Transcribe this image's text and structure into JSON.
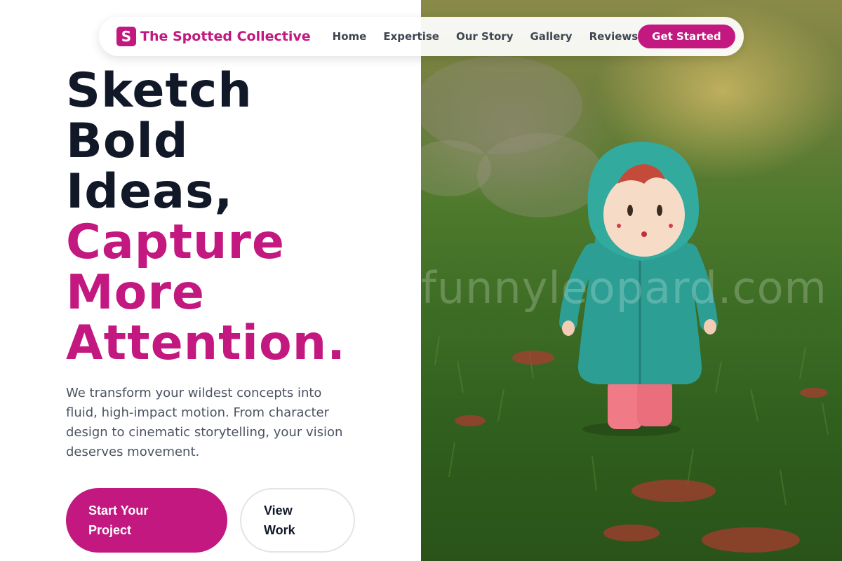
{
  "nav": {
    "brand_mark": "S",
    "brand_name": "The Spotted Collective",
    "links": [
      {
        "label": "Home"
      },
      {
        "label": "Expertise"
      },
      {
        "label": "Our Story"
      },
      {
        "label": "Gallery"
      },
      {
        "label": "Reviews"
      }
    ],
    "cta_label": "Get Started"
  },
  "hero": {
    "headline_dark": [
      "Sketch",
      "Bold",
      "Ideas,"
    ],
    "headline_accent": [
      "Capture",
      "More",
      "Attention."
    ],
    "subtext": "We transform your wildest concepts into fluid, high-impact motion. From character design to cinematic storytelling, your vision deserves movement.",
    "primary_button_label": "Start Your Project",
    "secondary_button_label": "View Work"
  },
  "photo": {
    "subject": "toy figurine in teal hooded raincoat standing on grass",
    "watermark": "funnyleopard.com"
  },
  "colors": {
    "accent": "#c2187f",
    "headline_dark": "#111827",
    "body_text": "#4b5361",
    "nav_text": "#3f4652"
  }
}
